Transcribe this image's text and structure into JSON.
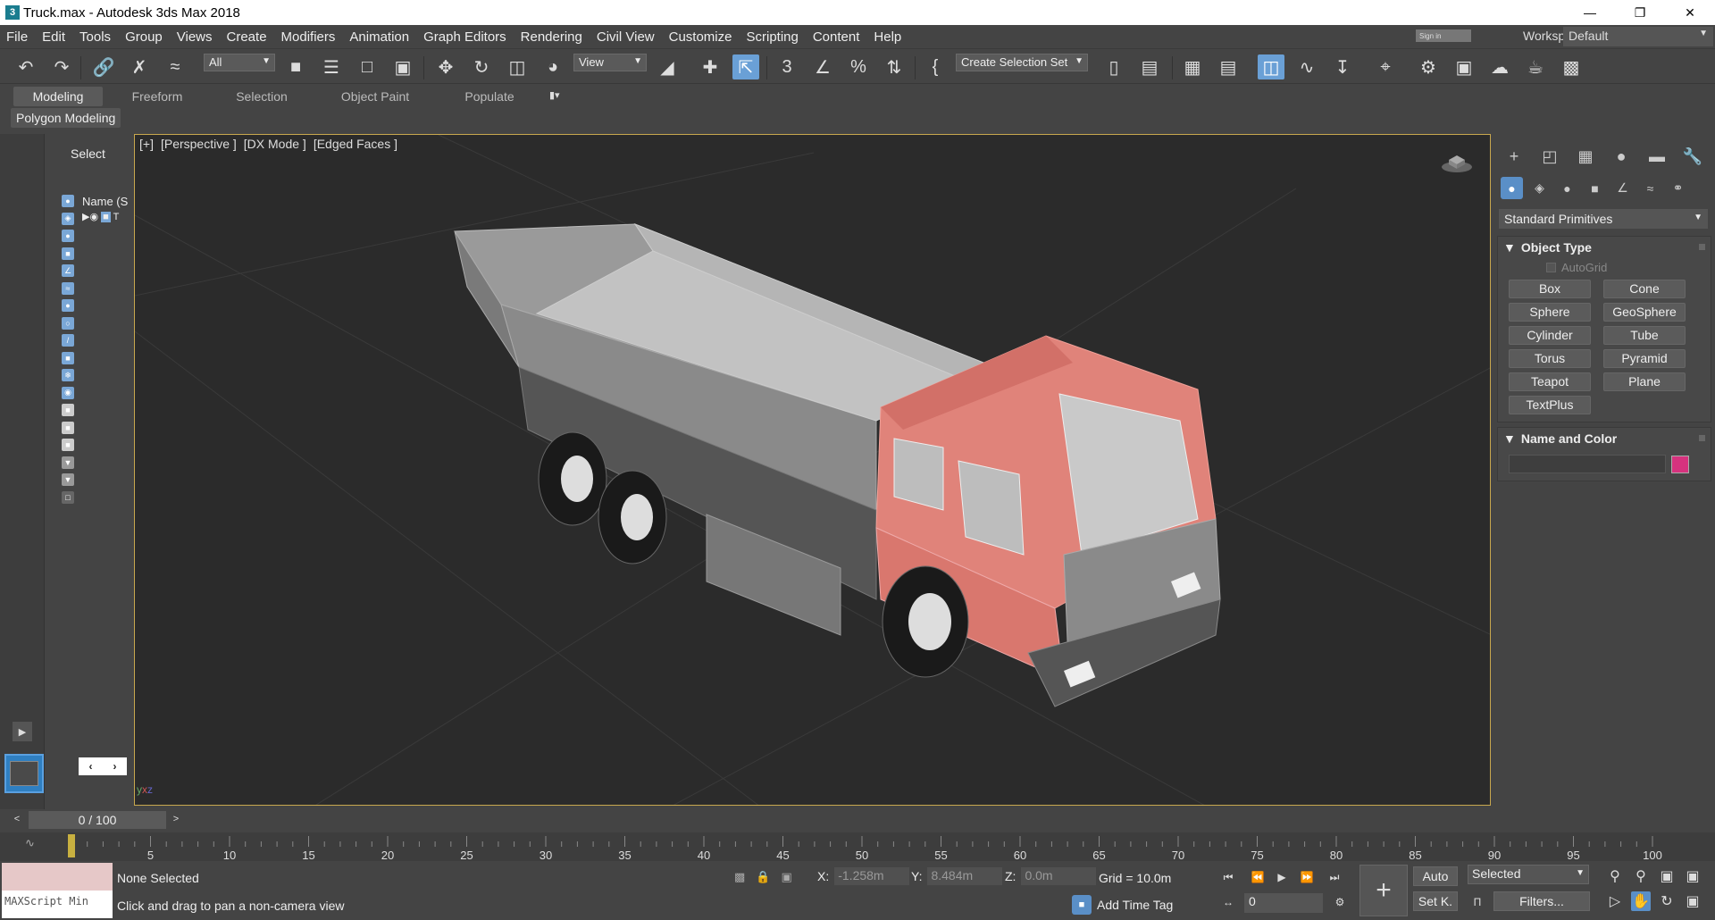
{
  "window": {
    "title": "Truck.max - Autodesk 3ds Max 2018",
    "app_icon": "3",
    "controls": [
      "minimize-icon",
      "restore-icon",
      "close-icon"
    ]
  },
  "menubar": {
    "items": [
      "File",
      "Edit",
      "Tools",
      "Group",
      "Views",
      "Create",
      "Modifiers",
      "Animation",
      "Graph Editors",
      "Rendering",
      "Civil View",
      "Customize",
      "Scripting",
      "Content",
      "Help"
    ],
    "signin": "Sign in",
    "workspaces_label": "Workspaces:",
    "workspace_value": "Default"
  },
  "toolbar": {
    "selection_filter": "All",
    "ref_coord": "View",
    "selection_set": "Create Selection Set"
  },
  "ribbon": {
    "tabs": [
      "Modeling",
      "Freeform",
      "Selection",
      "Object Paint",
      "Populate"
    ],
    "active_tab": "Modeling",
    "subtab": "Polygon Modeling"
  },
  "explorer": {
    "header": "Select",
    "column_name": "Name (S",
    "row_label": "T"
  },
  "viewport": {
    "labels": [
      "[+]",
      "[Perspective ]",
      "[DX Mode ]",
      "[Edged Faces ]"
    ],
    "axis_label": "xyz"
  },
  "command_panel": {
    "dropdown": "Standard Primitives",
    "object_type": {
      "title": "Object Type",
      "autogrid": "AutoGrid",
      "buttons": [
        "Box",
        "Cone",
        "Sphere",
        "GeoSphere",
        "Cylinder",
        "Tube",
        "Torus",
        "Pyramid",
        "Teapot",
        "Plane",
        "TextPlus"
      ]
    },
    "name_color": {
      "title": "Name and Color",
      "swatch_color": "#d6327e"
    }
  },
  "timeslider": {
    "frame_display": "0 / 100",
    "ticks": [
      "5",
      "10",
      "15",
      "20",
      "25",
      "30",
      "35",
      "40",
      "45",
      "50",
      "55",
      "60",
      "65",
      "70",
      "75",
      "80",
      "85",
      "90",
      "95",
      "100"
    ]
  },
  "status": {
    "maxscript_label": "MAXScript Min",
    "selection_status": "None Selected",
    "prompt": "Click and drag to pan a non-camera view",
    "x_label": "X:",
    "x_value": "-1.258m",
    "y_label": "Y:",
    "y_value": "8.484m",
    "z_label": "Z:",
    "z_value": "0.0m",
    "grid": "Grid = 10.0m",
    "add_time_tag": "Add Time Tag",
    "current_frame": "0",
    "auto_key": "Auto",
    "set_key": "Set K.",
    "key_filter_dropdown": "Selected",
    "filters": "Filters..."
  }
}
